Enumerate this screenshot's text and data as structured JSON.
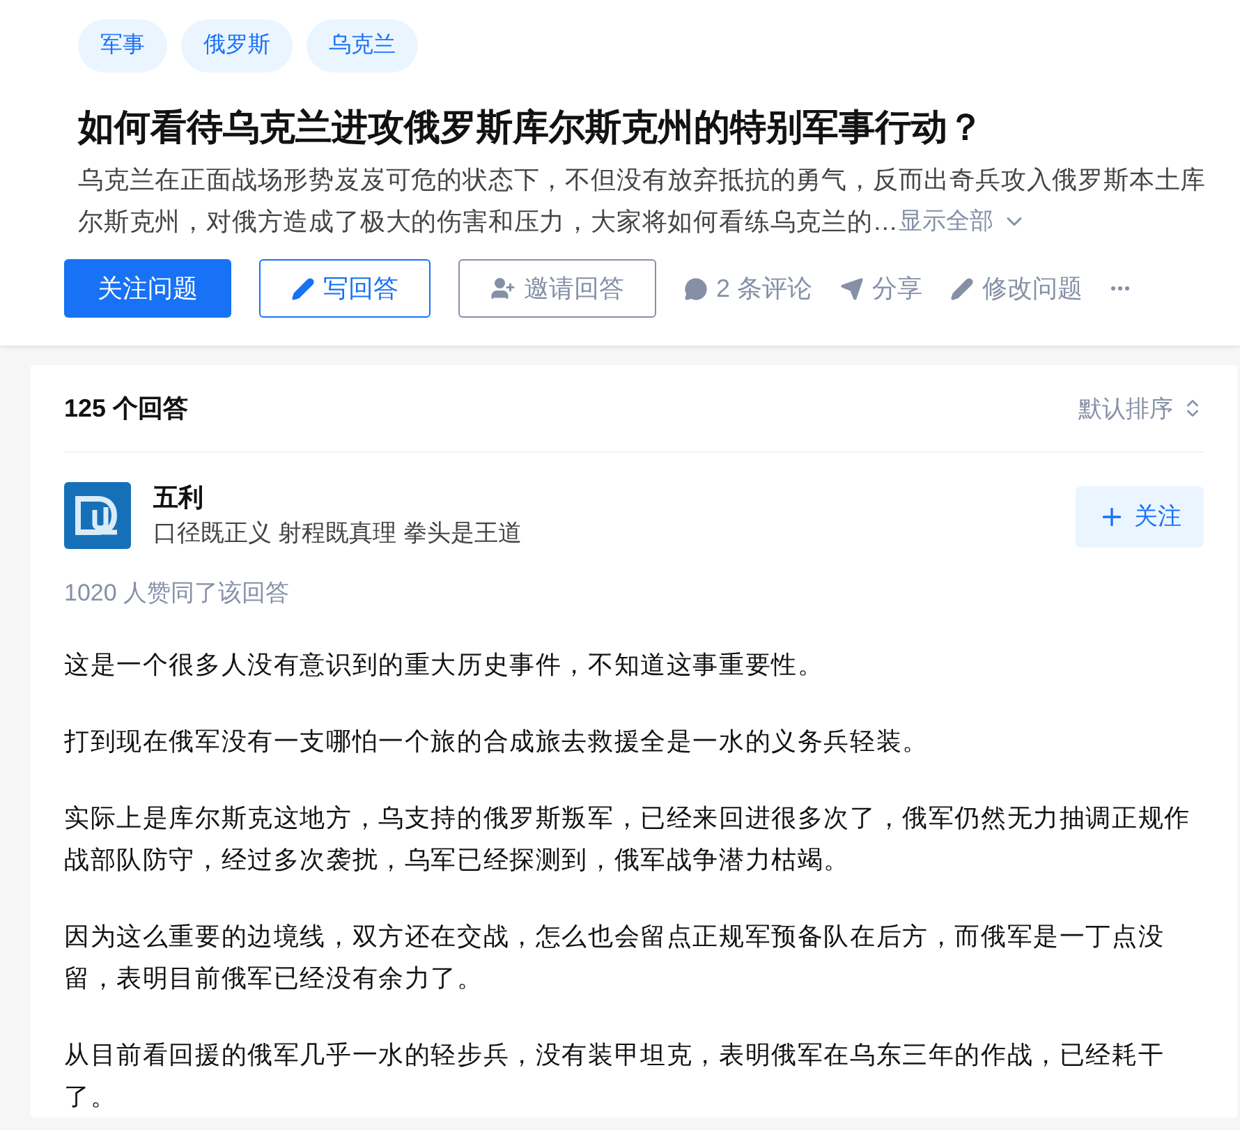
{
  "tags": [
    {
      "label": "军事"
    },
    {
      "label": "俄罗斯"
    },
    {
      "label": "乌克兰"
    }
  ],
  "question": {
    "title": "如何看待乌克兰进攻俄罗斯库尔斯克州的特别军事行动？",
    "description_lines": [
      "乌克兰在正面战场形势岌岌可危的状态下，不但没有放弃抵抗的勇气，反而出奇兵攻入俄罗斯本土库",
      "尔斯克州，对俄方造成了极大的伤害和压力，大家将如何看练乌克兰的…"
    ],
    "expand_label": "显示全部"
  },
  "actions": [
    {
      "kind": "follow",
      "label": "关注问题"
    },
    {
      "kind": "write",
      "label": "写回答"
    },
    {
      "kind": "invite",
      "label": "邀请回答"
    },
    {
      "kind": "comment",
      "label": "2 条评论"
    },
    {
      "kind": "share",
      "label": "分享"
    },
    {
      "kind": "edit",
      "label": "修改问题"
    },
    {
      "kind": "more"
    }
  ],
  "answers_header": {
    "count": "125 个回答",
    "sort": "默认排序"
  },
  "answer": {
    "author": "五利",
    "bio": "口径既正义 射程既真理 拳头是王道",
    "follow_label": "关注",
    "votes": "1020 人赞同了该回答",
    "paragraphs": [
      "这是一个很多人没有意识到的重大历史事件，不知道这事重要性。",
      "打到现在俄军没有一支哪怕一个旅的合成旅去救援全是一水的义务兵轻装。",
      "实际上是库尔斯克这地方，乌支持的俄罗斯叛军，已经来回进很多次了，俄军仍然无力抽调正规作战部队防守，经过多次袭扰，乌军已经探测到，俄军战争潜力枯竭。",
      "因为这么重要的边境线，双方还在交战，怎么也会留点正规军预备队在后方，而俄军是一丁点没留，表明目前俄军已经没有余力了。",
      "从目前看回援的俄军几乎一水的轻步兵，没有装甲坦克，表明俄军在乌东三年的作战，已经耗干了。"
    ]
  }
}
